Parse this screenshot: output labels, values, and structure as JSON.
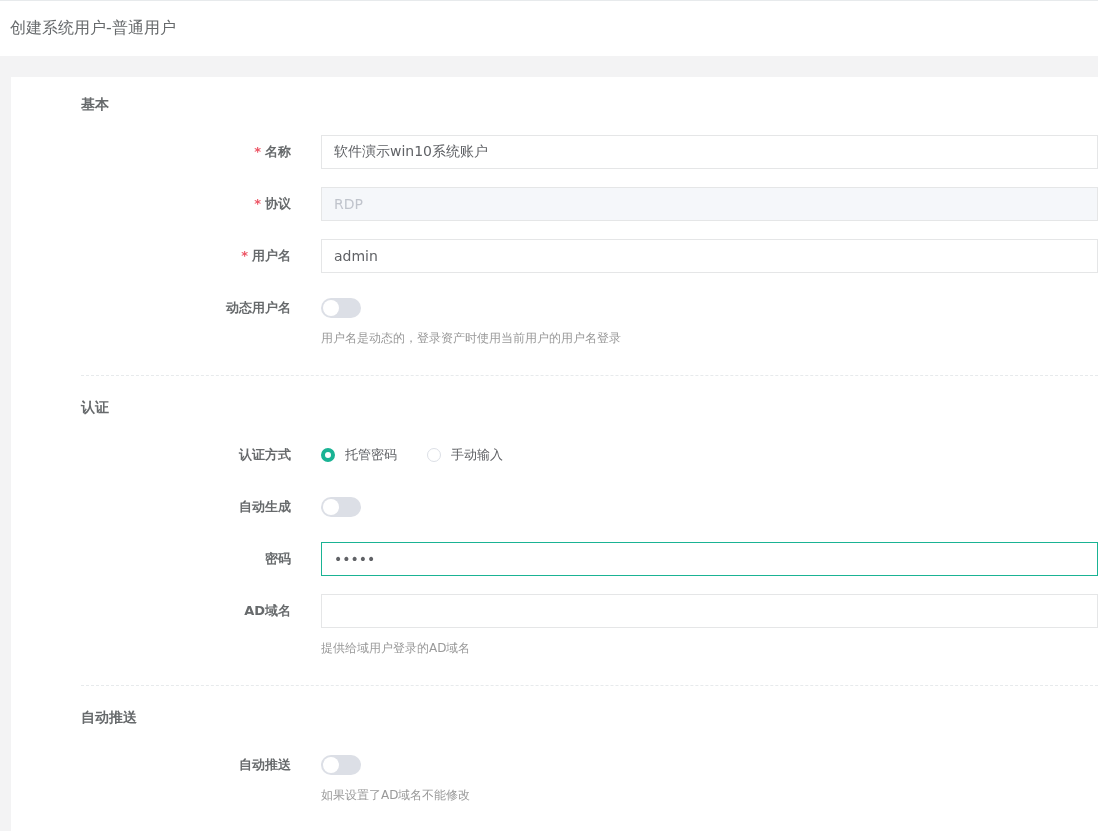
{
  "page_title": "创建系统用户-普通用户",
  "sections": [
    {
      "title": "基本",
      "fields": [
        {
          "kind": "text",
          "label": "名称",
          "required_mark": "*",
          "value": "软件演示win10系统账户"
        },
        {
          "kind": "text",
          "label": "协议",
          "required_mark": "*",
          "value": "RDP",
          "disabled": true
        },
        {
          "kind": "text",
          "label": "用户名",
          "required_mark": "*",
          "value": "admin"
        },
        {
          "kind": "switch",
          "label": "动态用户名",
          "on": false,
          "hint": "用户名是动态的，登录资产时使用当前用户的用户名登录"
        }
      ]
    },
    {
      "title": "认证",
      "fields": [
        {
          "kind": "radio",
          "label": "认证方式",
          "options": [
            {
              "label": "托管密码",
              "selected": true
            },
            {
              "label": "手动输入",
              "selected": false
            }
          ]
        },
        {
          "kind": "switch",
          "label": "自动生成",
          "on": false
        },
        {
          "kind": "text",
          "label": "密码",
          "value": "•••••",
          "focused": true
        },
        {
          "kind": "text",
          "label": "AD域名",
          "hint": "提供给域用户登录的AD域名"
        }
      ]
    },
    {
      "title": "自动推送",
      "fields": [
        {
          "kind": "switch",
          "label": "自动推送",
          "on": false,
          "hint": "如果设置了AD域名不能修改"
        }
      ]
    }
  ]
}
